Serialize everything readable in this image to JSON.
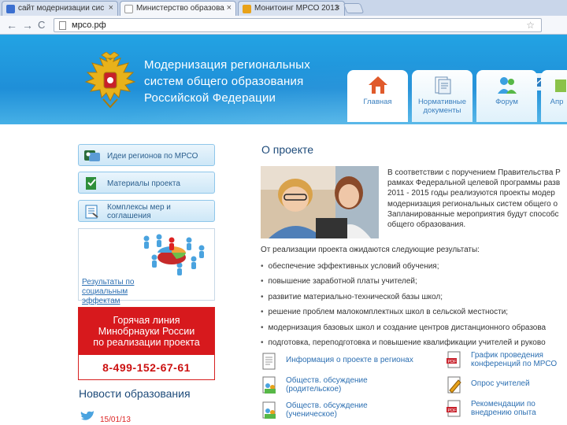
{
  "browser": {
    "tabs": [
      {
        "label": "сайт модернизации сис",
        "active": false,
        "favicon_color": "#3b6fd0"
      },
      {
        "label": "Министерство образова",
        "active": true,
        "favicon_color": "#ffffff"
      },
      {
        "label": "Монитоинг МРСО 2013",
        "active": false,
        "favicon_color": "#e8a219"
      }
    ],
    "close_glyph": "×",
    "back_glyph": "←",
    "forward_glyph": "→",
    "reload_glyph": "C",
    "url": "мрсо.рф",
    "star_glyph": "☆"
  },
  "header": {
    "title_lines": [
      "Модернизация региональных",
      "систем общего образования",
      "Российской Федерации"
    ],
    "nav_tabs": [
      {
        "label": "Главная",
        "icon": "home-icon"
      },
      {
        "label": "Нормативные документы",
        "icon": "documents-icon"
      },
      {
        "label": "Форум",
        "icon": "forum-icon"
      },
      {
        "label": "Апр",
        "icon": "extra-icon"
      }
    ],
    "colors": {
      "header_blue": "#1f8fd8",
      "tab_text": "#3a7fbf"
    }
  },
  "sidebar": {
    "buttons": [
      {
        "label": "Идеи регионов по МРСО",
        "icon": "ideas-icon"
      },
      {
        "label": "Материалы проекта",
        "icon": "materials-icon"
      },
      {
        "label": "Комплексы мер и соглашения",
        "icon": "agreements-icon"
      }
    ],
    "social_label": "Результаты по социальным эффектам",
    "hotline": {
      "lines": [
        "Горячая линия",
        "Минобрнауки России",
        "по реализации проекта"
      ],
      "phone": "8-499-152-67-61",
      "color": "#d7191d"
    },
    "news_title": "Новости образования",
    "news_date": "15/01/13"
  },
  "main": {
    "about_title": "О проекте",
    "about_lines": [
      "В соответствии с поручением Правительства Р",
      "рамках Федеральной целевой программы разв",
      "2011 - 2015 годы реализуются проекты модер",
      "модернизация региональных систем общего о",
      "Запланированные мероприятия будут способс",
      "общего образования."
    ],
    "results_intro": "От реализации проекта ожидаются следующие результаты:",
    "results": [
      "обеспечение эффективных условий обучения;",
      "повышение заработной платы учителей;",
      "развитие материально-технической базы школ;",
      "решение проблем малокомплектных школ в сельской местности;",
      "модернизация базовых школ и создание центров дистанционного образова",
      "подготовка, переподготовка и повышение квалификации учителей и руково"
    ],
    "documents": [
      {
        "label": "Информация о проекте в регионах",
        "icon": "info-doc-icon"
      },
      {
        "label": "График проведения конференций по МРСО",
        "icon": "pdf-icon"
      },
      {
        "label": "Обществ. обсуждение (родительское)",
        "icon": "people-doc-icon"
      },
      {
        "label": "Опрос учителей",
        "icon": "pencil-doc-icon"
      },
      {
        "label": "Обществ. обсуждение (ученическое)",
        "icon": "people-doc-icon"
      },
      {
        "label": "Рекомендации по внедрению опыта",
        "icon": "pdf-icon"
      }
    ]
  }
}
